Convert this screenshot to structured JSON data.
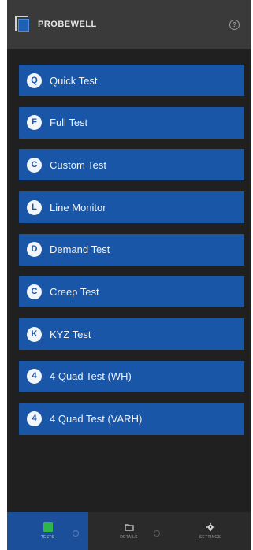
{
  "header": {
    "brand": "PROBEWELL",
    "help_icon": "question-circle-icon"
  },
  "menu": {
    "items": [
      {
        "badge": "Q",
        "label": "Quick Test"
      },
      {
        "badge": "F",
        "label": "Full Test"
      },
      {
        "badge": "C",
        "label": "Custom Test"
      },
      {
        "badge": "L",
        "label": "Line Monitor"
      },
      {
        "badge": "D",
        "label": "Demand Test"
      },
      {
        "badge": "C",
        "label": "Creep Test"
      },
      {
        "badge": "K",
        "label": "KYZ Test"
      },
      {
        "badge": "4",
        "label": "4 Quad Test (WH)"
      },
      {
        "badge": "4",
        "label": "4 Quad Test (VARH)"
      }
    ]
  },
  "bottom_nav": {
    "tabs": [
      {
        "label": "TESTS",
        "icon": "tests-icon",
        "active": true
      },
      {
        "label": "DETAILS",
        "icon": "folder-icon",
        "active": false
      },
      {
        "label": "SETTINGS",
        "icon": "gear-icon",
        "active": false
      }
    ]
  },
  "colors": {
    "accent": "#1956a8",
    "background": "#202020",
    "header": "#3a3a3a",
    "active_tab_icon": "#2fb64a"
  }
}
